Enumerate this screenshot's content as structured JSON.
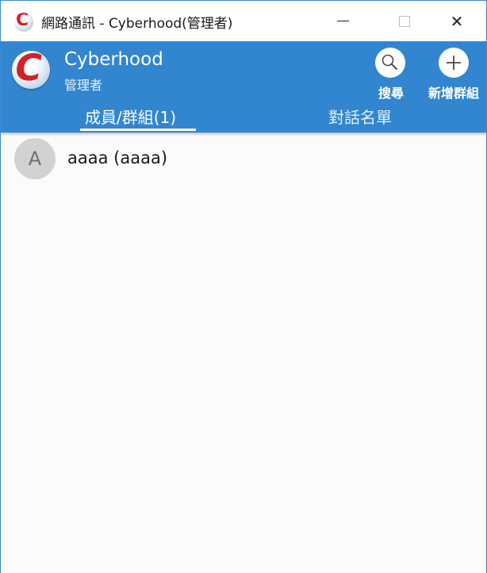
{
  "window": {
    "title": "網路通訊 - Cyberhood(管理者)",
    "minimize_glyph": "—",
    "close_glyph": "✕"
  },
  "header": {
    "user_name": "Cyberhood",
    "user_role": "管理者",
    "search_label": "搜尋",
    "add_group_label": "新增群組"
  },
  "tabs": [
    {
      "label": "成員/群組(1)",
      "active": true
    },
    {
      "label": "對話名單",
      "active": false
    }
  ],
  "members": [
    {
      "initial": "A",
      "name": "aaaa (aaaa)"
    }
  ],
  "icons": {
    "app": "cyberhood-logo-icon",
    "search": "magnifier-icon",
    "add": "plus-icon"
  },
  "colors": {
    "header_bg": "#3286d0",
    "logo_red": "#d61f26",
    "avatar_bg": "#d2d2d2"
  }
}
